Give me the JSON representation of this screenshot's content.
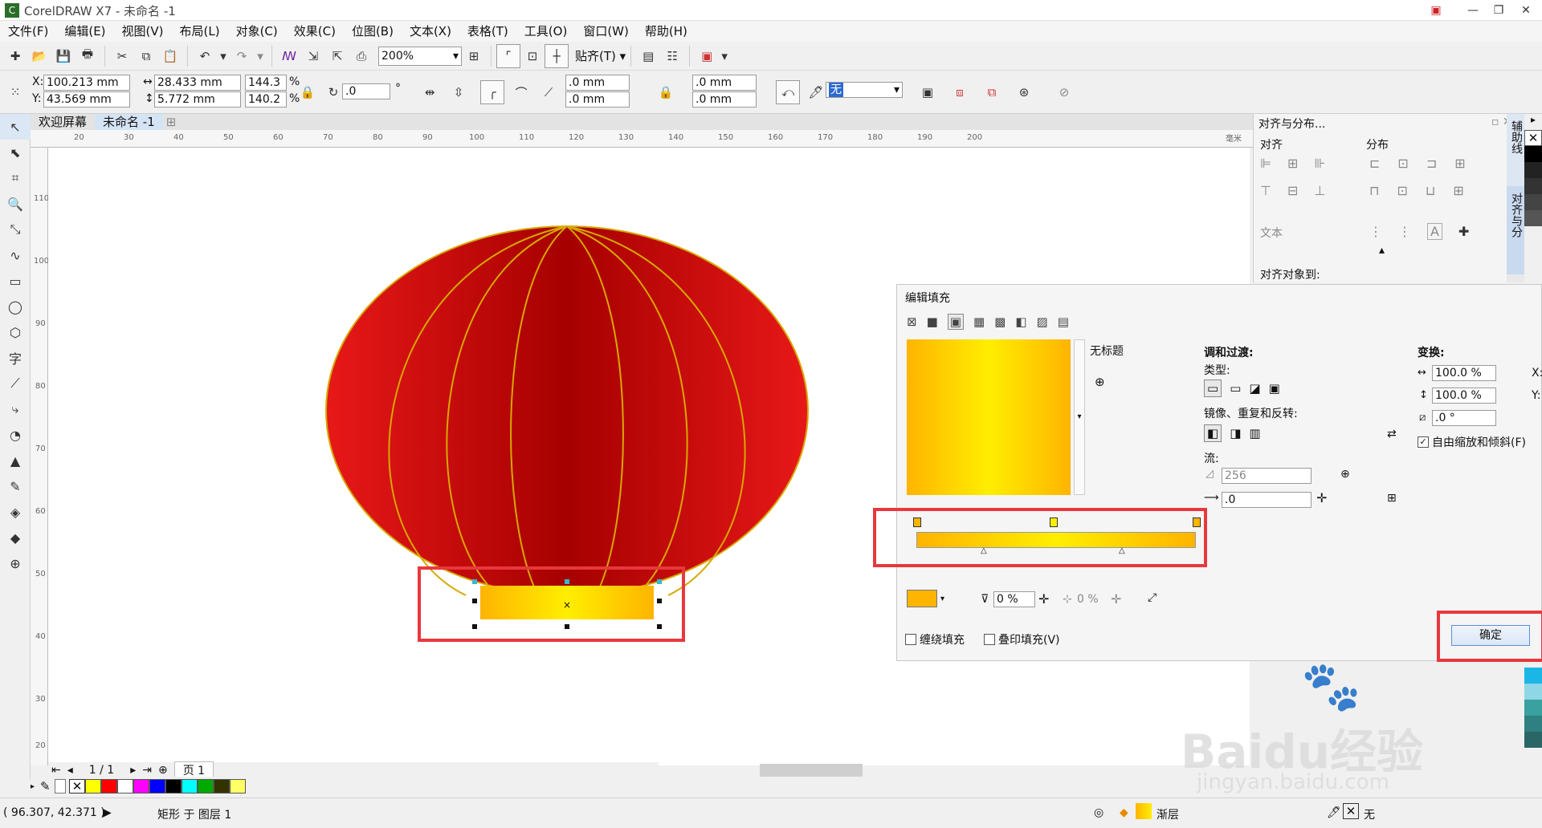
{
  "window": {
    "title": "CorelDRAW X7 - 未命名 -1"
  },
  "menu": [
    "文件(F)",
    "编辑(E)",
    "视图(V)",
    "布局(L)",
    "对象(C)",
    "效果(C)",
    "位图(B)",
    "文本(X)",
    "表格(T)",
    "工具(O)",
    "窗口(W)",
    "帮助(H)"
  ],
  "toolbar1": {
    "zoom": "200%",
    "snap": "贴齐(T)"
  },
  "props": {
    "x": "100.213 mm",
    "y": "43.569 mm",
    "w": "28.433 mm",
    "h": "5.772 mm",
    "sx": "144.3",
    "sy": "140.2",
    "pct": "%",
    "rotate": ".0",
    "deg": "°",
    "corner1": ".0 mm",
    "corner2": ".0 mm",
    "corner3": ".0 mm",
    "corner4": ".0 mm",
    "outline": "无"
  },
  "tabs": {
    "welcome": "欢迎屏幕",
    "doc": "未命名 -1"
  },
  "ruler": {
    "h": [
      "20",
      "30",
      "40",
      "50",
      "60",
      "70",
      "80",
      "90",
      "100",
      "110",
      "120",
      "130",
      "140",
      "150",
      "160",
      "170",
      "180",
      "190",
      "200"
    ],
    "unit": "毫米",
    "v": [
      "110",
      "100",
      "90",
      "80",
      "70",
      "60",
      "50",
      "40",
      "30",
      "20"
    ]
  },
  "page_nav": {
    "count": "1 / 1",
    "page": "页 1"
  },
  "docker": {
    "title": "对齐与分布...",
    "align": "对齐",
    "distribute": "分布",
    "text": "文本",
    "align_to": "对齐对象到:",
    "side_tab1": "辅助线",
    "side_tab2": "对齐与分"
  },
  "dialog": {
    "title": "编辑填充",
    "untitled": "无标题",
    "blend": "调和过渡:",
    "type": "类型:",
    "mirror": "镜像、重复和反转:",
    "flow": "流:",
    "steps": "256",
    "accel": ".0",
    "transform": "变换:",
    "scale_x": "100.0 %",
    "scale_y": "100.0 %",
    "angle": ".0 °",
    "x_label": "X:",
    "y_label": "Y:",
    "free_scale": "自由缩放和倾斜(F)",
    "opacity": "0 %",
    "position": "0 %",
    "wrap": "缠绕填充",
    "overprint": "叠印填充(V)",
    "ok": "确定"
  },
  "status": {
    "coords": "( 96.307, 42.371 )",
    "object": "矩形 于 图层 1",
    "fill": "渐层",
    "outline": "无"
  },
  "watermark": {
    "brand": "Baidu经验",
    "url": "jingyan.baidu.com"
  },
  "colors": {
    "lantern_red": "#e01010",
    "lantern_dark": "#a80000",
    "rib": "#d6a800",
    "grad_yellow": "#ffee00",
    "grad_orange": "#ffb400",
    "highlight": "#e8383d"
  },
  "palette": [
    "#ffff00",
    "#ff0000",
    "#ffffff",
    "#ff00ff",
    "#0000ff",
    "#000000",
    "#00ffff",
    "#00aa00",
    "#333300",
    "#ffff66"
  ]
}
